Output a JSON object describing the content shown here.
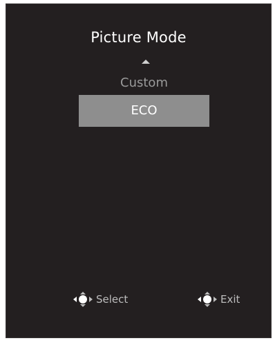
{
  "menu": {
    "title": "Picture Mode",
    "options": [
      {
        "label": "Custom",
        "selected": false
      },
      {
        "label": "ECO",
        "selected": true
      }
    ]
  },
  "footer": {
    "select_label": "Select",
    "exit_label": "Exit",
    "select_icon": "joystick-icon",
    "exit_icon": "joystick-icon"
  },
  "colors": {
    "background": "#231f20",
    "highlight": "#8e8e8e",
    "title_text": "#ffffff",
    "dim_text": "#9a9a9a"
  }
}
